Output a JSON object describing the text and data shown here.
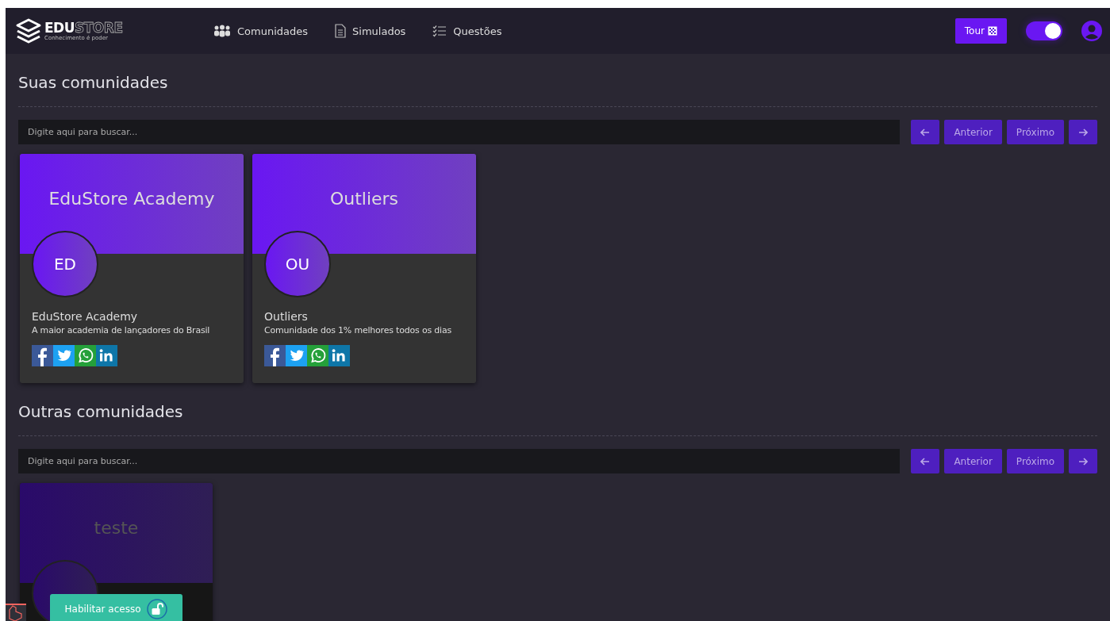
{
  "header": {
    "logo": {
      "brand_primary": "EDU",
      "brand_secondary": "STORE",
      "tagline": "Conhecimento é poder"
    },
    "nav": [
      {
        "label": "Comunidades",
        "kind": "people"
      },
      {
        "label": "Simulados",
        "kind": "document"
      },
      {
        "label": "Questões",
        "kind": "checklist"
      }
    ],
    "tour_button": "Tour",
    "theme_toggle": {
      "on": true
    }
  },
  "sections": [
    {
      "title": "Suas comunidades",
      "search": {
        "placeholder": "Digite aqui para buscar..."
      },
      "pager": {
        "previous": "Anterior",
        "next": "Próximo"
      },
      "communities": [
        {
          "banner_title": "EduStore Academy",
          "initials": "ED",
          "name": "EduStore Academy",
          "description": "A maior academia de lançadores do Brasil",
          "locked": false
        },
        {
          "banner_title": "Outliers",
          "initials": "OU",
          "name": "Outliers",
          "description": "Comunidade dos 1% melhores todos os dias",
          "locked": false
        }
      ]
    },
    {
      "title": "Outras comunidades",
      "search": {
        "placeholder": "Digite aqui para buscar..."
      },
      "pager": {
        "previous": "Anterior",
        "next": "Próximo"
      },
      "communities": [
        {
          "banner_title": "teste",
          "locked": true
        }
      ]
    }
  ],
  "access_button": "Habilitar acesso"
}
